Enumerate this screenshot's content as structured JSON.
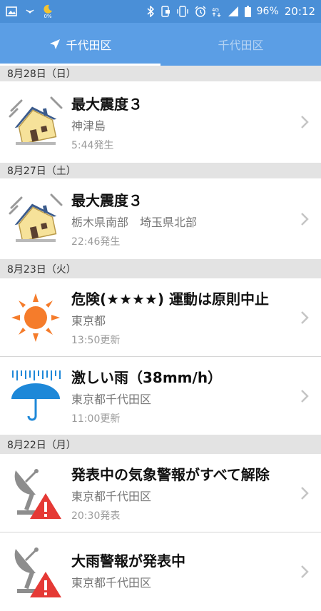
{
  "status_bar": {
    "left_icons": [
      "image-icon",
      "nfc-icon",
      "moon-icon"
    ],
    "moon_percent": "0%",
    "right_icons": [
      "bluetooth-icon",
      "phone-lock-icon",
      "vibrate-icon",
      "alarm-icon",
      "4g-icon",
      "signal-icon",
      "battery-icon"
    ],
    "battery": "96%",
    "time": "20:12"
  },
  "tabs": [
    {
      "label": "千代田区",
      "active": true,
      "icon": "location-arrow-icon"
    },
    {
      "label": "千代田区",
      "active": false
    }
  ],
  "sections": [
    {
      "date": "8月28日（日）",
      "items": [
        {
          "icon": "earthquake-house-icon",
          "title": "最大震度３",
          "subtitle": "神津島",
          "time": "5:44発生"
        }
      ]
    },
    {
      "date": "8月27日（土）",
      "items": [
        {
          "icon": "earthquake-house-icon",
          "title": "最大震度３",
          "subtitle": "栃木県南部　埼玉県北部",
          "time": "22:46発生"
        }
      ]
    },
    {
      "date": "8月23日（火）",
      "items": [
        {
          "icon": "sun-icon",
          "title": "危険(★★★★) 運動は原則中止",
          "subtitle": "東京都",
          "time": "13:50更新"
        },
        {
          "icon": "heavy-rain-umbrella-icon",
          "title": "激しい雨（38mm/h）",
          "subtitle": "東京都千代田区",
          "time": "11:00更新"
        }
      ]
    },
    {
      "date": "8月22日（月）",
      "items": [
        {
          "icon": "satellite-warning-icon",
          "title": "発表中の気象警報がすべて解除",
          "subtitle": "東京都千代田区",
          "time": "20:30発表"
        },
        {
          "icon": "satellite-warning-icon",
          "title": "大雨警報が発表中",
          "subtitle": "東京都千代田区",
          "time": ""
        }
      ]
    }
  ],
  "colors": {
    "status_bar": "#4a8fd7",
    "tab_bar": "#5b9ee5",
    "date_header_bg": "#e3e3e3",
    "sun": "#f57c2b",
    "umbrella": "#1e88d8",
    "warning": "#e53935"
  }
}
